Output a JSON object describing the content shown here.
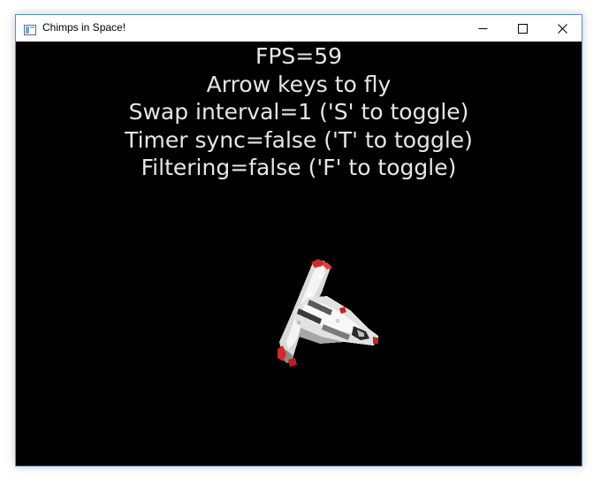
{
  "window": {
    "title": "Chimps in Space!",
    "icon": "generic-app-icon",
    "controls": [
      "minimize-icon",
      "maximize-icon",
      "close-icon"
    ]
  },
  "hud": {
    "fps": "FPS=59",
    "instructions": "Arrow keys to fly",
    "swap_interval": "Swap interval=1 ('S' to toggle)",
    "timer_sync": "Timer sync=false ('T' to toggle)",
    "filtering": "Filtering=false ('F' to toggle)"
  },
  "scene": {
    "background": "#000000",
    "text_color": "#e6e6e6",
    "sprite": "spaceship-sprite",
    "sprite_colors": [
      "#f0f0f0",
      "#9a9a9a",
      "#3c3c3c",
      "#d02a2a"
    ]
  }
}
